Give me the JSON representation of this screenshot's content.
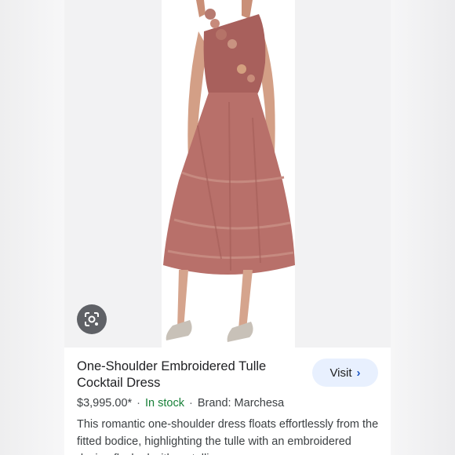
{
  "product": {
    "title": "One-Shoulder Embroidered Tulle Cocktail Dress",
    "price": "$3,995.00*",
    "separator": "·",
    "stock": "In stock",
    "brand": "Brand: Marchesa",
    "description": "This romantic one-shoulder dress floats effortlessly from the fitted bodice, highlighting the tulle with an embroidered design flecked with metallic"
  },
  "visit": {
    "label": "Visit",
    "chevron": "›"
  },
  "colors": {
    "stock": "#188038",
    "visit_bg": "#e8f0fe",
    "lens_bg": "#5f6166",
    "dress": "#b8706a"
  },
  "icons": {
    "lens": "google-lens-icon",
    "chevron": "chevron-right-icon"
  }
}
